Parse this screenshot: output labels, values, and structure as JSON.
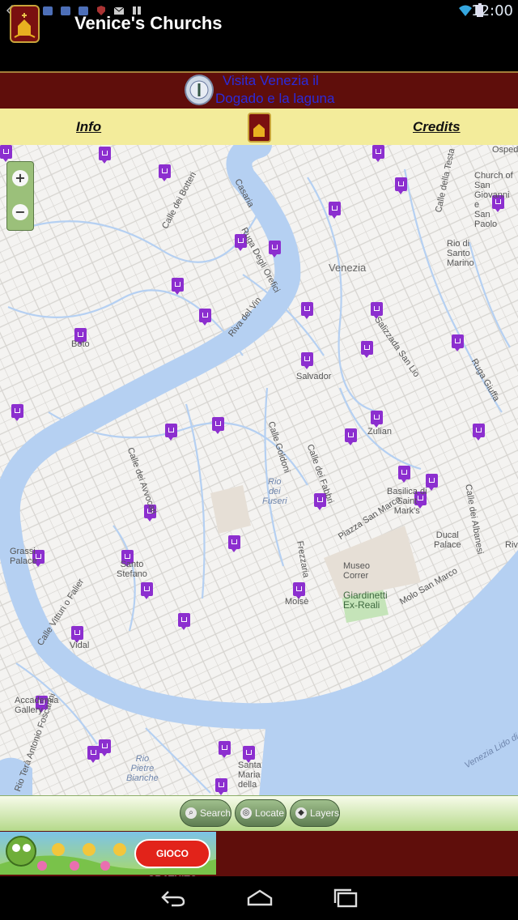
{
  "status_bar": {
    "time": "12:00",
    "icons": [
      "notification-icon",
      "ubuntu-icon",
      "ubuntu-icon",
      "ubuntu-icon",
      "ubuntu-icon",
      "shield-icon",
      "mail-icon",
      "bars-icon"
    ],
    "right_icons": [
      "wifi-icon",
      "battery-icon"
    ]
  },
  "app": {
    "title": "Venice's Churchs",
    "logo_icon": "church-logo-icon"
  },
  "banner": {
    "line1": "Visita Venezia il",
    "line2": "Dogado e la laguna",
    "seal_icon": "venice-seal-icon"
  },
  "nav": {
    "info": "Info",
    "credits": "Credits",
    "logo_icon": "church-logo-icon"
  },
  "map": {
    "zoom_in": "+",
    "zoom_out": "−",
    "labels": {
      "venezia": "Venezia",
      "salvador": "Salvador",
      "zulian": "Zulian",
      "basilica": "Basilica di\nSaint\nMark's",
      "ducal": "Ducal\nPalace",
      "museo": "Museo\nCorrer",
      "giardinetti": "Giardinetti\nEx-Reali",
      "rio_fuseri": "Rio\ndei\nFuseri",
      "molo": "Molo San Marco",
      "piazza": "Piazza San Marco",
      "grassi": "Grassi\nPalace",
      "stefano": "Santo\nStefano",
      "vidal": "Vidal",
      "mona": "Moisè",
      "accademia": "Accademia\nGallery",
      "rio_pietre": "Rio\nPietre\nBianche",
      "santa_maria": "Santa\nMaria\ndella",
      "church_sgp": "Church of\nSan\nGiovanni\ne\nSan\nPaolo",
      "ospedale": "Ospedal",
      "rio_santo": "Rio di\nSanto\nMarino",
      "boto": "Boto",
      "rio_vin": "Riva del Vin",
      "calle_botteri": "Calle dei Botteri",
      "casaria": "Casaria",
      "ruga_ori": "Ruga Degli Orefici",
      "salizzada": "Salizzada San Lio",
      "ruga_giuffa": "Ruga Giuffa",
      "calle_testa": "Calle della Testa",
      "calle_goldoni": "Calle Goldoni",
      "calle_fabbri": "Calle dei Fabbri",
      "calle_avvocati": "Calle dei Avvocati",
      "frezzaria": "Frezzaria",
      "calle_albanesi": "Calle dei Albanesi",
      "calle_vitturi": "Calle Vitturi o Falier",
      "rio_foscarini": "Rio Terà Antonio Foscarini",
      "venezia_lido": "Venezia Lido di Ve",
      "riva": "Riva"
    }
  },
  "toolbar": {
    "search": "Search",
    "locate": "Locate",
    "layers": "Layers"
  },
  "ad": {
    "cta": "GIOCO GRATUITO"
  },
  "system_nav": {
    "back": "back-icon",
    "home": "home-icon",
    "recents": "recents-icon"
  },
  "colors": {
    "banner_red": "#5f0e0b",
    "nav_yellow": "#f3ec9b",
    "water": "#b5d0f2",
    "pin": "#8c2fcf",
    "banner_text": "#2b2bdb"
  }
}
